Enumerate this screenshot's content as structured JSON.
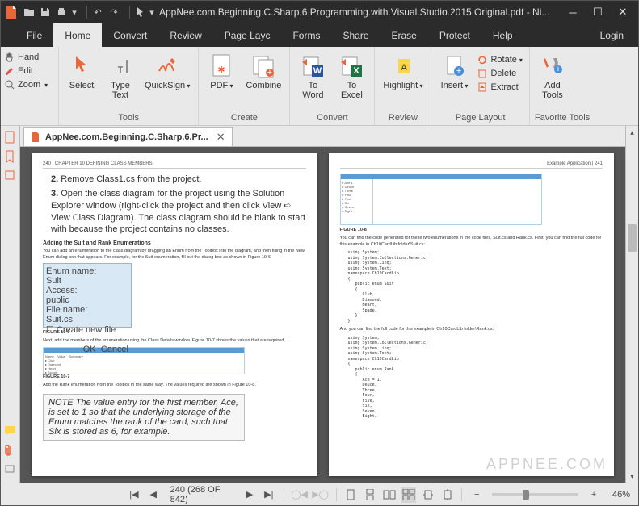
{
  "title": "AppNee.com.Beginning.C.Sharp.6.Programming.with.Visual.Studio.2015.Original.pdf - Ni...",
  "menu": {
    "file": "File",
    "home": "Home",
    "convert": "Convert",
    "review": "Review",
    "pagelayc": "Page Layc",
    "forms": "Forms",
    "share": "Share",
    "erase": "Erase",
    "protect": "Protect",
    "help": "Help",
    "login": "Login"
  },
  "tools": {
    "hand": "Hand",
    "edit": "Edit",
    "zoom": "Zoom"
  },
  "ribbon": {
    "select": "Select",
    "typetext": "Type\nText",
    "quicksign": "QuickSign",
    "tools_label": "Tools",
    "pdf": "PDF",
    "combine": "Combine",
    "create_label": "Create",
    "toword": "To\nWord",
    "toexcel": "To\nExcel",
    "convert_label": "Convert",
    "highlight": "Highlight",
    "review_label": "Review",
    "insert": "Insert",
    "rotate": "Rotate",
    "delete": "Delete",
    "extract": "Extract",
    "pagelayout_label": "Page Layout",
    "addtools": "Add\nTools",
    "fav_label": "Favorite Tools"
  },
  "tab": {
    "label": "AppNee.com.Beginning.C.Sharp.6.Pr..."
  },
  "status": {
    "page": "240 (268 OF 842)",
    "zoom": "46%"
  },
  "watermark": "APPNEE.COM",
  "page_left": {
    "header": "240 | CHAPTER 10   DEFINING CLASS MEMBERS",
    "li2": "Remove Class1.cs from the project.",
    "li3": "Open the class diagram for the project using the Solution Explorer window (right-click the project and then click View ➪ View Class Diagram). The class diagram should be blank to start with because the project contains no classes.",
    "h1": "Adding the Suit and Rank Enumerations",
    "p1": "You can add an enumeration to the class diagram by dragging an Enum from the Toolbox into the diagram, and then filling in the New Enum dialog box that appears. For example, for the Suit enumeration, fill out the dialog box as shown in Figure 10-6.",
    "fig1": "FIGURE 10-6",
    "p2": "Next, add the members of the enumeration using the Class Details window. Figure 10-7 shows the values that are required.",
    "fig2": "FIGURE 10-7",
    "p3": "Add the Rank enumeration from the Toolbox in the same way. The values required are shown in Figure 10-8.",
    "note": "NOTE  The value entry for the first member, Ace, is set to 1 so that the underlying storage of the Enum matches the rank of the card, such that Six is stored as 6, for example."
  },
  "page_right": {
    "header": "Example Application | 241",
    "fig3": "FIGURE 10-8",
    "p1": "You can find the code generated for these two enumerations in the code files, Suit.cs and Rank.cs. First, you can find the full code for this example in Ch10CardLib folder\\Suit.cs:",
    "code1": "using System;\nusing System.Collections.Generic;\nusing System.Linq;\nusing System.Text;\nnamespace Ch10CardLib\n{\n   public enum Suit\n   {\n      Club,\n      Diamond,\n      Heart,\n      Spade,\n   }\n}",
    "p2": "And you can find the full code for this example in Ch10CardLib folder\\Rank.cs:",
    "code2": "using System;\nusing System.Collections.Generic;\nusing System.Linq;\nusing System.Text;\nnamespace Ch10CardLib\n{\n   public enum Rank\n   {\n      Ace = 1,\n      Deuce,\n      Three,\n      Four,\n      Five,\n      Six,\n      Seven,\n      Eight,"
  }
}
